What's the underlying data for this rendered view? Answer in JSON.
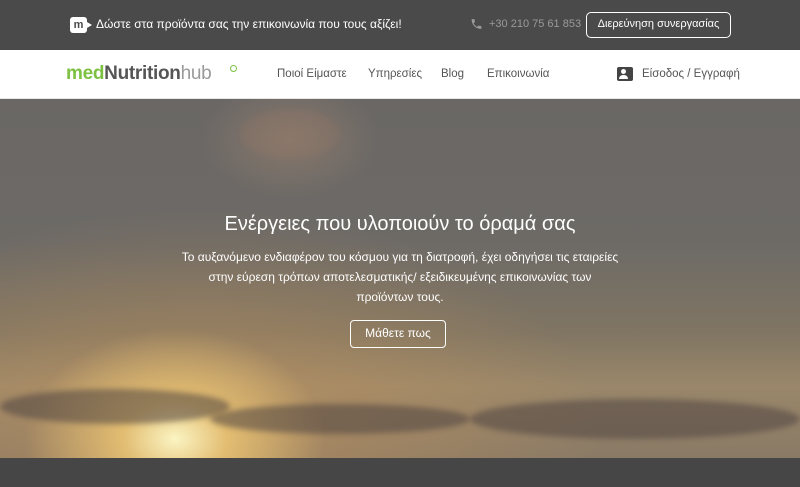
{
  "topbar": {
    "badge_letter": "m",
    "tagline": "Δώστε στα προϊόντα σας την επικοινωνία που τους αξίζει!",
    "phone_icon": "phone-icon",
    "phone": "+30 210 75 61 853",
    "cta_label": "Διερεύνηση συνεργασίας"
  },
  "nav": {
    "logo": {
      "part1": "med",
      "part2": "Nutrition",
      "part3": "hub"
    },
    "items": [
      {
        "label": "Ποιοί Είμαστε"
      },
      {
        "label": "Υπηρεσίες"
      },
      {
        "label": "Blog"
      },
      {
        "label": "Επικοινωνία"
      }
    ],
    "login_icon": "user-icon",
    "login_label": "Είσοδος / Εγγραφή"
  },
  "hero": {
    "title": "Ενέργειες που υλοποιούν το όραμά σας",
    "description": "Το αυξανόμενο ενδιαφέρον του κόσμου για τη διατροφή, έχει οδηγήσει τις εταιρείες στην εύρεση τρόπων αποτελεσματικής/ εξειδικευμένης επικοινωνίας των προϊόντων τους.",
    "button_label": "Μάθετε πως"
  },
  "colors": {
    "brand_green": "#7cc142",
    "topbar_bg": "#4a4a4a",
    "text_dark": "#555555"
  }
}
